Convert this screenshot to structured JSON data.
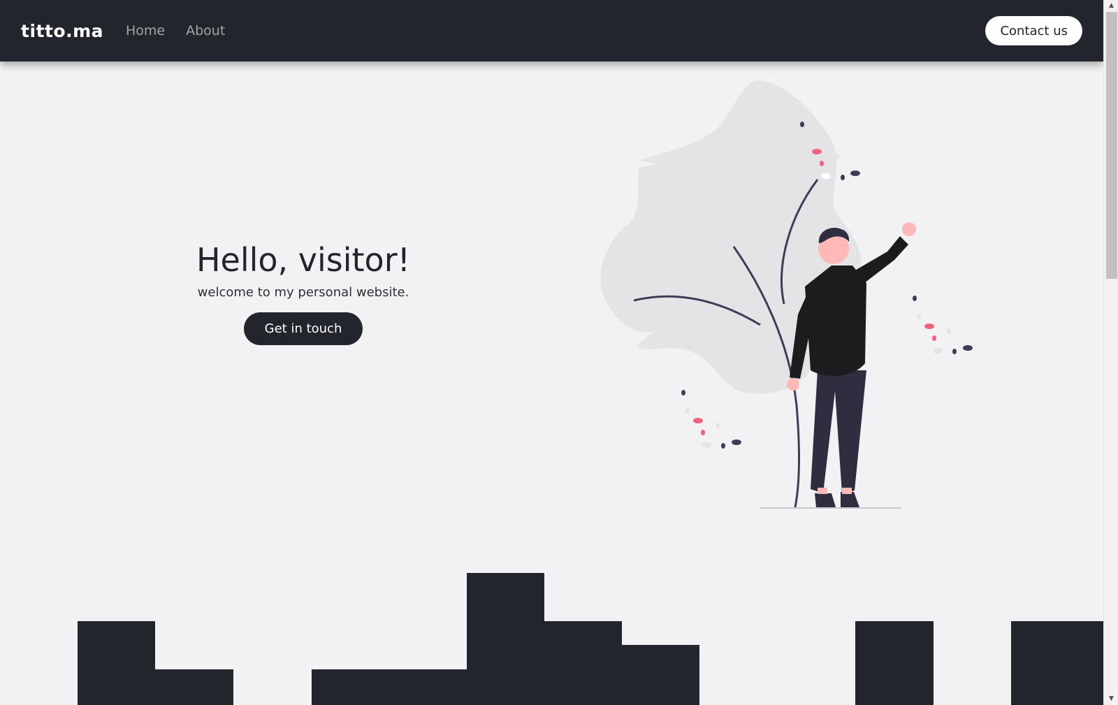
{
  "navbar": {
    "brand": "titto.ma",
    "links": [
      {
        "label": "Home"
      },
      {
        "label": "About"
      }
    ],
    "contact_label": "Contact us"
  },
  "hero": {
    "title": "Hello, visitor!",
    "subtitle": "welcome to my personal website.",
    "cta_label": "Get in touch"
  },
  "colors": {
    "navbar_bg": "#22252b",
    "page_bg": "#f2f2f4",
    "accent_pink": "#f2647e",
    "figure_dark": "#3f3d56"
  },
  "icons": {
    "scroll_up": "scroll-up-arrow-icon",
    "scroll_down": "scroll-down-arrow-icon"
  },
  "scrollbar": {
    "up_glyph": "▲",
    "down_glyph": "▼"
  }
}
